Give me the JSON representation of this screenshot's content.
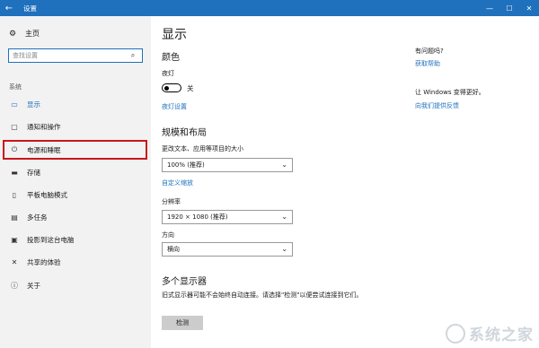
{
  "window": {
    "title": "设置",
    "back_icon": "←",
    "minimize": "—",
    "maximize": "☐",
    "close": "✕"
  },
  "sidebar": {
    "home_label": "主页",
    "search_placeholder": "查找设置",
    "section_label": "系统",
    "items": [
      {
        "label": "显示",
        "icon": "display-icon",
        "active": true
      },
      {
        "label": "通知和操作",
        "icon": "message-icon"
      },
      {
        "label": "电源和睡眠",
        "icon": "power-icon"
      },
      {
        "label": "存储",
        "icon": "storage-icon"
      },
      {
        "label": "平板电脑模式",
        "icon": "tablet-icon"
      },
      {
        "label": "多任务",
        "icon": "multitask-icon"
      },
      {
        "label": "投影到这台电脑",
        "icon": "project-icon"
      },
      {
        "label": "共享的体验",
        "icon": "share-icon"
      },
      {
        "label": "关于",
        "icon": "info-icon"
      }
    ]
  },
  "main": {
    "title": "显示",
    "color_heading": "颜色",
    "nightlight_label": "夜灯",
    "nightlight_state": "关",
    "nightlight_settings": "夜灯设置",
    "scale_heading": "规模和布局",
    "scale_label": "更改文本、应用等项目的大小",
    "scale_value": "100% (推荐)",
    "custom_scale_link": "自定义缩放",
    "resolution_label": "分辨率",
    "resolution_value": "1920 × 1080 (推荐)",
    "orientation_label": "方向",
    "orientation_value": "横向",
    "multi_display_heading": "多个显示器",
    "multi_display_text": "旧式显示器可能不会始终自动连接。请选择\"检测\"以便尝试连接到它们。",
    "detect_button": "检测"
  },
  "right_panel": {
    "question_heading": "有问题吗?",
    "get_help_link": "获取帮助",
    "better_heading": "让 Windows 变得更好。",
    "feedback_link": "向我们提供反馈"
  },
  "watermark": {
    "text": "系统之家"
  },
  "colors": {
    "accent": "#1f70bd",
    "highlight": "#c8161d",
    "sidebar_bg": "#f2f2f2"
  }
}
